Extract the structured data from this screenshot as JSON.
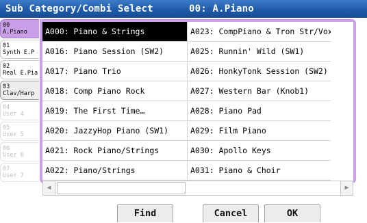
{
  "title": {
    "label": "Sub Category/Combi Select",
    "current": "00: A.Piano"
  },
  "colors": {
    "title_bar": "#1f5aa8",
    "accent": "#c9a0e8",
    "selected_row_bg": "#000000"
  },
  "tabs": [
    {
      "num": "00",
      "name": "A.Piano",
      "state": "active"
    },
    {
      "num": "01",
      "name": "Synth E.P",
      "state": "normal"
    },
    {
      "num": "02",
      "name": "Real E.Pia",
      "state": "normal"
    },
    {
      "num": "03",
      "name": "Clav/Harp",
      "state": "selected"
    },
    {
      "num": "04",
      "name": "User 4",
      "state": "disabled"
    },
    {
      "num": "05",
      "name": "User 5",
      "state": "disabled"
    },
    {
      "num": "06",
      "name": "User 6",
      "state": "disabled"
    },
    {
      "num": "07",
      "name": "User 7",
      "state": "disabled"
    }
  ],
  "list": {
    "left": [
      "A000: Piano & Strings",
      "A016: Piano Session (SW2)",
      "A017: Piano Trio",
      "A018: Comp Piano Rock",
      "A019: The First Time…",
      "A020: JazzyHop Piano (SW1)",
      "A021: Rock Piano/Strings",
      "A022: Piano/Strings"
    ],
    "right": [
      "A023: CompPiano & Tron Str/Vox",
      "A025: Runnin' Wild (SW1)",
      "A026: HonkyTonk Session (SW2)",
      "A027: Western Bar (Knob1)",
      "A028: Piano Pad",
      "A029: Film Piano",
      "A030: Apollo Keys",
      "A031: Piano & Choir"
    ],
    "selected": "A000: Piano & Strings"
  },
  "scrollbar": {
    "left_icon": "arrow-left-icon",
    "right_icon": "arrow-right-icon"
  },
  "buttons": {
    "find": "Find",
    "cancel": "Cancel",
    "ok": "OK"
  }
}
